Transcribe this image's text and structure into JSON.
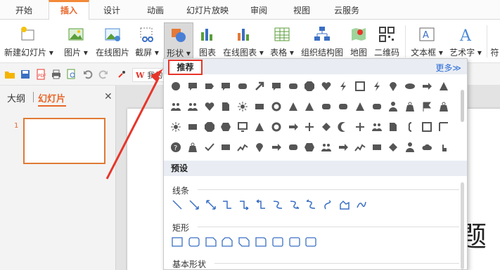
{
  "tabs": [
    "开始",
    "插入",
    "设计",
    "动画",
    "幻灯片放映",
    "审阅",
    "视图",
    "云服务"
  ],
  "ribbon": {
    "new_slide": "新建幻灯片 ▾",
    "picture": "图片 ▾",
    "online_picture": "在线图片",
    "screenshot": "截屏 ▾",
    "shapes": "形状 ▾",
    "chart": "图表",
    "online_chart": "在线图表 ▾",
    "table": "表格 ▾",
    "org_chart": "组织结构图",
    "map": "地图",
    "qrcode": "二维码",
    "textbox": "文本框 ▾",
    "art_text": "艺术字 ▾",
    "symbol": "符"
  },
  "quickbar": {
    "badge": "我的"
  },
  "left_panel": {
    "tab_outline": "大纲",
    "tab_slides": "幻灯片",
    "close": "✕",
    "slide_number": "1"
  },
  "slide": {
    "text": "题"
  },
  "dropdown": {
    "recommended": "推荐",
    "more": "更多≫",
    "preset": "预设",
    "lines": "线条",
    "rectangles": "矩形",
    "basic_shapes": "基本形状"
  },
  "colors": {
    "accent": "#e8662a",
    "highlight": "#e8352a",
    "link": "#2a6ad6"
  }
}
